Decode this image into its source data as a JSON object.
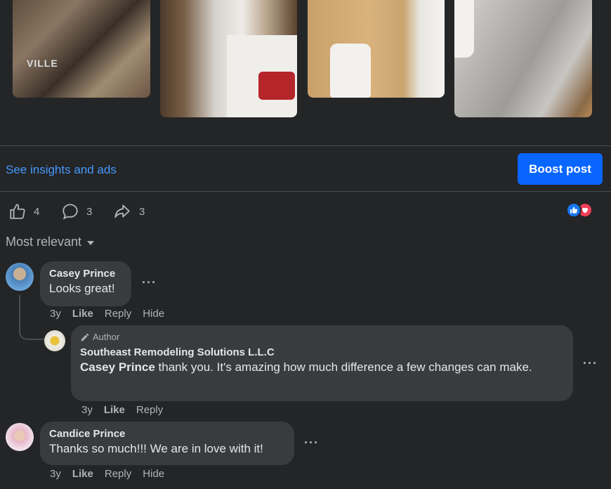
{
  "photos": {
    "photo1_text": "VILLE"
  },
  "post_actions": {
    "insights_link": "See insights and ads",
    "boost_button": "Boost post"
  },
  "engagement": {
    "likes": "4",
    "comments": "3",
    "shares": "3"
  },
  "colors": {
    "background": "#242526",
    "bubble": "#3a3b3c",
    "link_blue": "#4599ff",
    "boost_blue": "#0866ff",
    "like_blue": "#1877f2",
    "love_red": "#f33e58"
  },
  "sort": {
    "label": "Most relevant"
  },
  "comments": [
    {
      "author": "Casey Prince",
      "text": "Looks great!",
      "time": "3y",
      "like": "Like",
      "reply": "Reply",
      "hide": "Hide",
      "more": "···"
    },
    {
      "badge": "Author",
      "author": "Southeast Remodeling Solutions L.L.C",
      "mention": "Casey Prince",
      "text": " thank you. It's amazing how much difference a few changes can make.",
      "time": "3y",
      "like": "Like",
      "reply": "Reply",
      "more": "···"
    },
    {
      "author": "Candice Prince",
      "text": "Thanks so much!!! We are in love with it!",
      "time": "3y",
      "like": "Like",
      "reply": "Reply",
      "hide": "Hide",
      "more": "···"
    }
  ]
}
